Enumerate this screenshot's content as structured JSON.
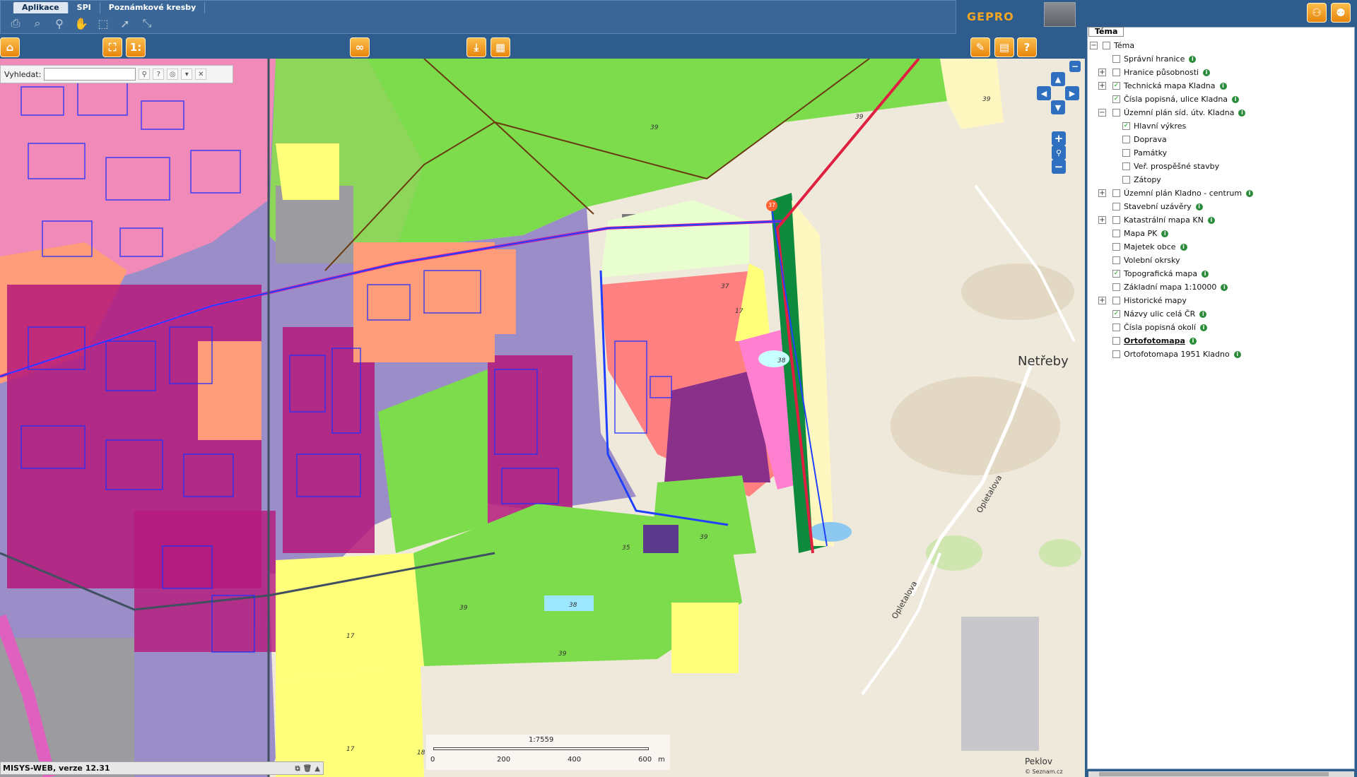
{
  "menu": {
    "tabs": [
      "Aplikace",
      "SPI",
      "Poznámkové kresby"
    ]
  },
  "logo": "GEPRO",
  "search": {
    "label": "Vyhledat:",
    "value": "",
    "placeholder": ""
  },
  "status": {
    "text": "MISYS-WEB, verze 12.31"
  },
  "scale": {
    "ratio": "1:7559",
    "ticks": [
      "0",
      "200",
      "400",
      "600",
      "m"
    ]
  },
  "map_labels": {
    "town": "Netřeby",
    "street1": "Opletalova",
    "street2": "Opletalova",
    "place": "Peklov",
    "attribution": "© Seznam.cz",
    "road_shield": "37"
  },
  "layers": {
    "panel_title": "Téma",
    "items": [
      {
        "label": "Téma",
        "expander": "minus",
        "checked": false,
        "level": 0,
        "info": false
      },
      {
        "label": "Správní hranice",
        "expander": "",
        "checked": false,
        "level": 1,
        "info": true
      },
      {
        "label": "Hranice působnosti",
        "expander": "plus",
        "checked": false,
        "level": 1,
        "info": true
      },
      {
        "label": "Technická mapa Kladna",
        "expander": "plus",
        "checked": true,
        "level": 1,
        "info": true
      },
      {
        "label": "Čísla popisná, ulice Kladna",
        "expander": "",
        "checked": true,
        "level": 1,
        "info": true
      },
      {
        "label": "Územní plán síd. útv. Kladna",
        "expander": "minus",
        "checked": false,
        "level": 1,
        "info": true
      },
      {
        "label": "Hlavní výkres",
        "expander": "",
        "checked": true,
        "level": 2,
        "info": false
      },
      {
        "label": "Doprava",
        "expander": "",
        "checked": false,
        "level": 2,
        "info": false
      },
      {
        "label": "Památky",
        "expander": "",
        "checked": false,
        "level": 2,
        "info": false
      },
      {
        "label": "Veř. prospěšné stavby",
        "expander": "",
        "checked": false,
        "level": 2,
        "info": false
      },
      {
        "label": "Zátopy",
        "expander": "",
        "checked": false,
        "level": 2,
        "info": false
      },
      {
        "label": "Územní plán Kladno - centrum",
        "expander": "plus",
        "checked": false,
        "level": 1,
        "info": true
      },
      {
        "label": "Stavební uzávěry",
        "expander": "",
        "checked": false,
        "level": 1,
        "info": true
      },
      {
        "label": "Katastrální mapa KN",
        "expander": "plus",
        "checked": false,
        "level": 1,
        "info": true
      },
      {
        "label": "Mapa PK",
        "expander": "",
        "checked": false,
        "level": 1,
        "info": true
      },
      {
        "label": "Majetek obce",
        "expander": "",
        "checked": false,
        "level": 1,
        "info": true
      },
      {
        "label": "Volební okrsky",
        "expander": "",
        "checked": false,
        "level": 1,
        "info": false
      },
      {
        "label": "Topografická mapa",
        "expander": "",
        "checked": true,
        "level": 1,
        "info": true
      },
      {
        "label": "Základní mapa 1:10000",
        "expander": "",
        "checked": false,
        "level": 1,
        "info": true
      },
      {
        "label": "Historické mapy",
        "expander": "plus",
        "checked": false,
        "level": 1,
        "info": false
      },
      {
        "label": "Názvy ulic celá ČR",
        "expander": "",
        "checked": true,
        "level": 1,
        "info": true
      },
      {
        "label": "Čísla popisná okolí",
        "expander": "",
        "checked": false,
        "level": 1,
        "info": true
      },
      {
        "label": "Ortofotomapa",
        "expander": "",
        "checked": false,
        "level": 1,
        "info": true,
        "bold": true
      },
      {
        "label": "Ortofotomapa 1951 Kladno",
        "expander": "",
        "checked": false,
        "level": 1,
        "info": true
      }
    ]
  },
  "colors": {
    "header_bg": "#2e5c8c",
    "accent_orange": "#f5a623",
    "nav_blue": "#2e6fbf"
  }
}
